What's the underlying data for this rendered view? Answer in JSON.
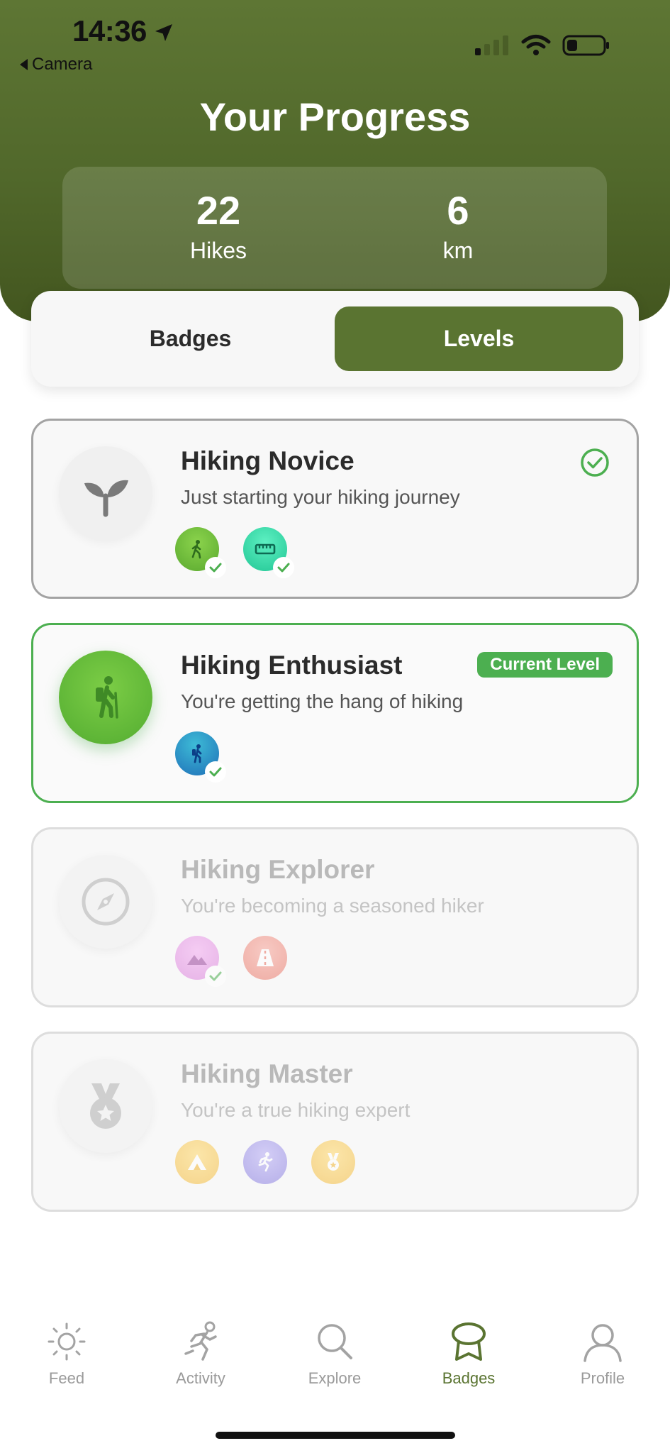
{
  "status_bar": {
    "time": "14:36",
    "back_label": "Camera"
  },
  "header": {
    "title": "Your Progress"
  },
  "stats": [
    {
      "value": "22",
      "label": "Hikes"
    },
    {
      "value": "6",
      "label": "km"
    }
  ],
  "segmented": {
    "badges_label": "Badges",
    "levels_label": "Levels",
    "selected": "Levels"
  },
  "levels": [
    {
      "title": "Hiking Novice",
      "description": "Just starting your hiking journey",
      "status": "completed",
      "icon": "sprout-icon"
    },
    {
      "title": "Hiking Enthusiast",
      "description": "You're getting the hang of hiking",
      "status": "current",
      "badge_text": "Current Level",
      "icon": "hiker-icon"
    },
    {
      "title": "Hiking Explorer",
      "description": "You're becoming a seasoned hiker",
      "status": "locked",
      "icon": "compass-icon"
    },
    {
      "title": "Hiking Master",
      "description": "You're a true hiking expert",
      "status": "locked",
      "icon": "medal-icon"
    }
  ],
  "tabbar": {
    "items": [
      {
        "label": "Feed",
        "icon": "sun-icon"
      },
      {
        "label": "Activity",
        "icon": "running-icon"
      },
      {
        "label": "Explore",
        "icon": "search-icon"
      },
      {
        "label": "Badges",
        "icon": "badge-icon",
        "active": true
      },
      {
        "label": "Profile",
        "icon": "person-icon"
      }
    ]
  },
  "colors": {
    "header_green": "#51682b",
    "accent_green": "#5a7431",
    "success_green": "#4caf50"
  }
}
